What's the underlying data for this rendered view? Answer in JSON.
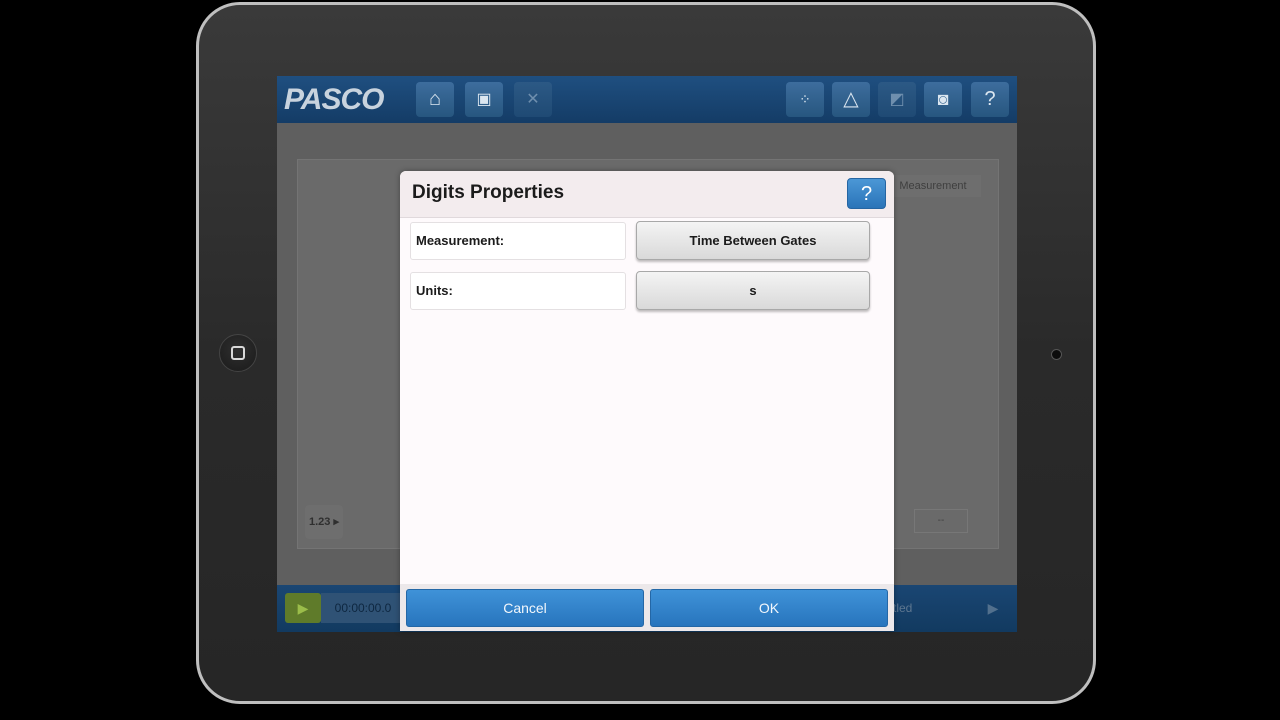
{
  "toolbar": {
    "logo": "PASCO",
    "icons": [
      "home-icon",
      "document-icon",
      "close-icon",
      "points-icon",
      "triangle-icon",
      "tool-icon",
      "camera-icon",
      "help-icon"
    ],
    "help_glyph": "?"
  },
  "background": {
    "measurement_label": "Measurement",
    "digits_button": "1.23 ▸",
    "digits_value": "--",
    "timer": "00:00:00.0",
    "filename": "titled"
  },
  "dialog": {
    "title": "Digits Properties",
    "help_glyph": "?",
    "rows": [
      {
        "label": "Measurement:",
        "value": "Time Between Gates"
      },
      {
        "label": "Units:",
        "value": "s"
      }
    ],
    "cancel_label": "Cancel",
    "ok_label": "OK"
  },
  "colors": {
    "toolbar": "#1f4f80",
    "dialog_button": "#2f82c8",
    "dialog_background": "#fefafc"
  }
}
